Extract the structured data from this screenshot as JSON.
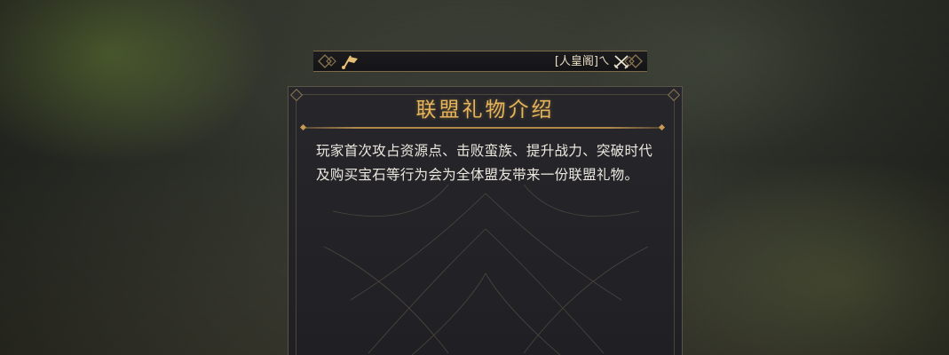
{
  "top_bar": {
    "player_name": "[人皇阁]ㄟ",
    "icons": [
      "flag-icon",
      "crossed-swords-icon"
    ]
  },
  "dialog": {
    "title": "联盟礼物介绍",
    "description": "玩家首次攻占资源点、击败蛮族、提升战力、突破时代及购买宝石等行为会为全体盟友带来一份联盟礼物。"
  },
  "colors": {
    "title": "#e6b45a",
    "body_text": "#ece8df",
    "frame_gold": "#b08a4c",
    "panel_bg": "#222226"
  }
}
